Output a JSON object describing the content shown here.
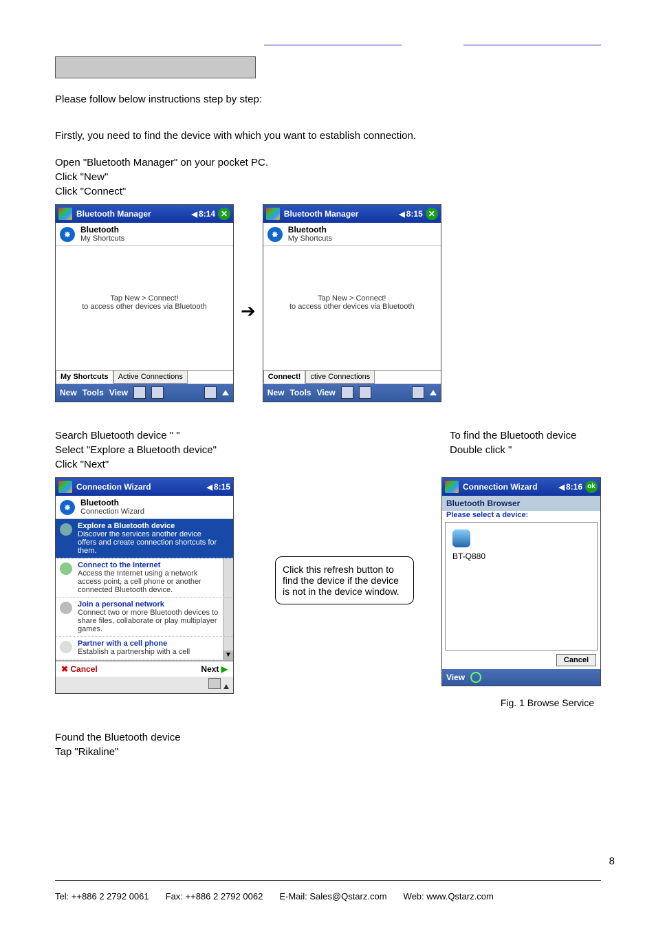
{
  "text": {
    "intro1": "Please follow below instructions step by step:",
    "intro2": "Firstly, you need to find the device with which you want to establish connection.",
    "step1a": "Open \"Bluetooth Manager\" on your pocket PC.",
    "step1b": "Click \"New\"",
    "step1c": "Click \"Connect\"",
    "search1": "Search Bluetooth device \"             \"",
    "search2": "Select \"Explore a Bluetooth device\"",
    "search3": "Click \"Next\"",
    "callout": "Click this refresh button to find the device if the device is not in the device window.",
    "find1": "To find the Bluetooth device",
    "find2": "Double click \"",
    "fig_caption": "Fig. 1         Browse Service",
    "found1": "Found the Bluetooth device",
    "found2": "Tap \"Rikaline\"",
    "page_num": "8"
  },
  "footer": {
    "tel": "Tel: ++886 2 2792 0061",
    "fax": "Fax: ++886 2 2792 0062",
    "email": "E-Mail: Sales@Qstarz.com",
    "web": "Web: www.Qstarz.com"
  },
  "shot1": {
    "title": "Bluetooth Manager",
    "time": "8:14",
    "close": "✕",
    "sub_h": "Bluetooth",
    "sub_s": "My Shortcuts",
    "body": "Tap New > Connect!\nto access other devices via Bluetooth",
    "tab1": "My Shortcuts",
    "tab2": "Active Connections",
    "menu": [
      "New",
      "Tools",
      "View"
    ]
  },
  "shot2": {
    "title": "Bluetooth Manager",
    "time": "8:15",
    "close": "✕",
    "sub_h": "Bluetooth",
    "sub_s": "My Shortcuts",
    "body": "Tap New > Connect!\nto access other devices via Bluetooth",
    "popup": "Connect!",
    "tab2": "ctive Connections",
    "menu": [
      "New",
      "Tools",
      "View"
    ]
  },
  "wizard": {
    "title": "Connection Wizard",
    "time": "8:15",
    "sub_h": "Bluetooth",
    "sub_s": "Connection Wizard",
    "items": [
      {
        "t": "Explore a Bluetooth device",
        "d": "Discover the services another device offers and create connection shortcuts for them.",
        "sel": true
      },
      {
        "t": "Connect to the Internet",
        "d": "Access the Internet using a network access point, a cell phone or another connected Bluetooth device."
      },
      {
        "t": "Join a personal network",
        "d": "Connect two or more Bluetooth devices to share files, collaborate or play multiplayer games."
      },
      {
        "t": "Partner with a cell phone",
        "d": "Establish a partnership with a cell"
      }
    ],
    "cancel": "Cancel",
    "next": "Next"
  },
  "browser": {
    "title": "Connection Wizard",
    "time": "8:16",
    "ok": "ok",
    "head": "Bluetooth Browser",
    "sub": "Please select a device:",
    "device": "BT-Q880",
    "cancel": "Cancel",
    "view": "View"
  }
}
